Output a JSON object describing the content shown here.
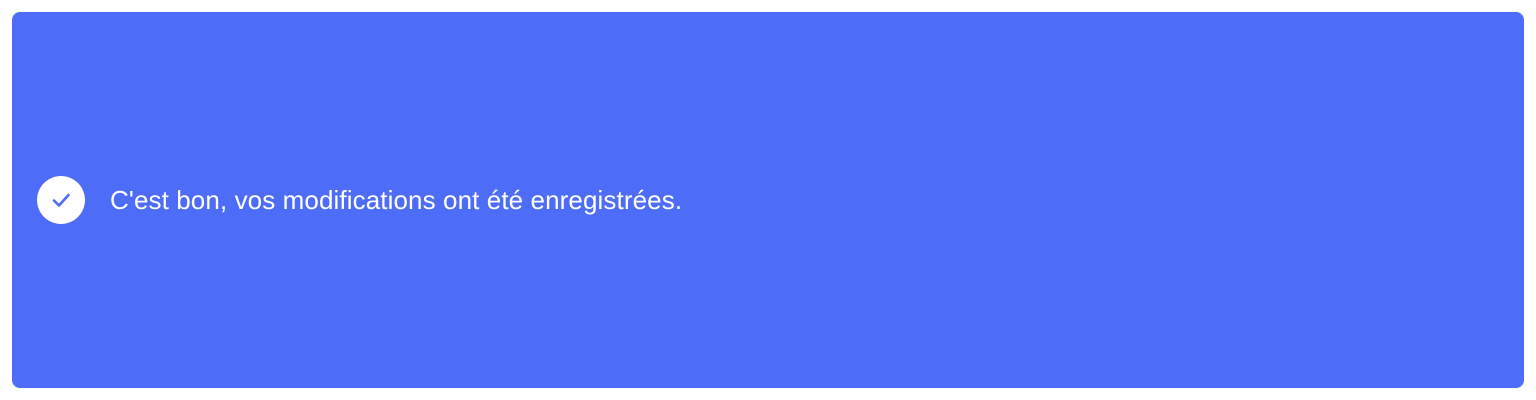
{
  "toast": {
    "message": "C'est bon, vos modifications ont été enregistrées.",
    "icon": "check-circle-icon",
    "background_color": "#4d6cf8",
    "text_color": "#ffffff"
  }
}
